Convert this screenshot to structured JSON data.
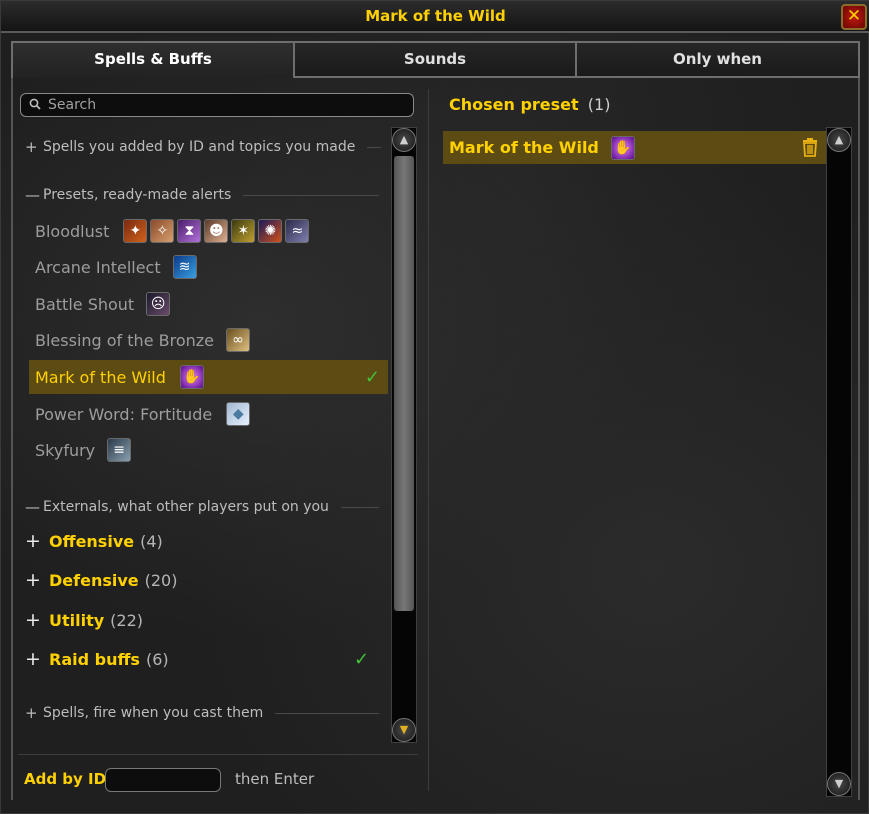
{
  "window": {
    "title": "Mark of the Wild"
  },
  "tabs": [
    {
      "label": "Spells & Buffs",
      "active": true
    },
    {
      "label": "Sounds",
      "active": false
    },
    {
      "label": "Only when",
      "active": false
    }
  ],
  "search": {
    "placeholder": "Search",
    "value": ""
  },
  "sections": {
    "custom": {
      "symbol": "+",
      "label": "Spells you added by ID and topics you made"
    },
    "presets": {
      "symbol": "—",
      "label": "Presets, ready-made alerts"
    },
    "externals": {
      "symbol": "—",
      "label": "Externals, what other players put on you"
    },
    "on_cast": {
      "symbol": "+",
      "label": "Spells, fire when you cast them"
    }
  },
  "presets": [
    {
      "label": "Bloodlust",
      "icons": [
        "bloodlust-icon",
        "heroism-icon",
        "time-warp-icon",
        "primal-rage-icon",
        "fury-of-aspects-icon",
        "drums-icon",
        "feral-hide-drums-icon"
      ],
      "selected": false
    },
    {
      "label": "Arcane Intellect",
      "icons": [
        "arcane-intellect-icon"
      ],
      "selected": false
    },
    {
      "label": "Battle Shout",
      "icons": [
        "battle-shout-icon"
      ],
      "selected": false
    },
    {
      "label": "Blessing of the Bronze",
      "icons": [
        "blessing-of-the-bronze-icon"
      ],
      "selected": false
    },
    {
      "label": "Mark of the Wild",
      "icons": [
        "mark-of-the-wild-icon"
      ],
      "selected": true,
      "checked": true
    },
    {
      "label": "Power Word: Fortitude",
      "icons": [
        "power-word-fortitude-icon"
      ],
      "selected": false
    },
    {
      "label": "Skyfury",
      "icons": [
        "skyfury-icon"
      ],
      "selected": false
    }
  ],
  "externals": [
    {
      "symbol": "+",
      "name": "Offensive",
      "count": "(4)",
      "checked": false
    },
    {
      "symbol": "+",
      "name": "Defensive",
      "count": "(20)",
      "checked": false
    },
    {
      "symbol": "+",
      "name": "Utility",
      "count": "(22)",
      "checked": false
    },
    {
      "symbol": "+",
      "name": "Raid buffs",
      "count": "(6)",
      "checked": true
    }
  ],
  "add_by_id": {
    "label": "Add by ID:",
    "value": "",
    "hint": "then Enter"
  },
  "chosen": {
    "label": "Chosen preset",
    "count": "(1)",
    "items": [
      {
        "label": "Mark of the Wild",
        "icon": "mark-of-the-wild-icon"
      }
    ]
  },
  "colors": {
    "accent": "#ffd100",
    "selected_row": "#5c4b12",
    "check": "#43c33a"
  }
}
